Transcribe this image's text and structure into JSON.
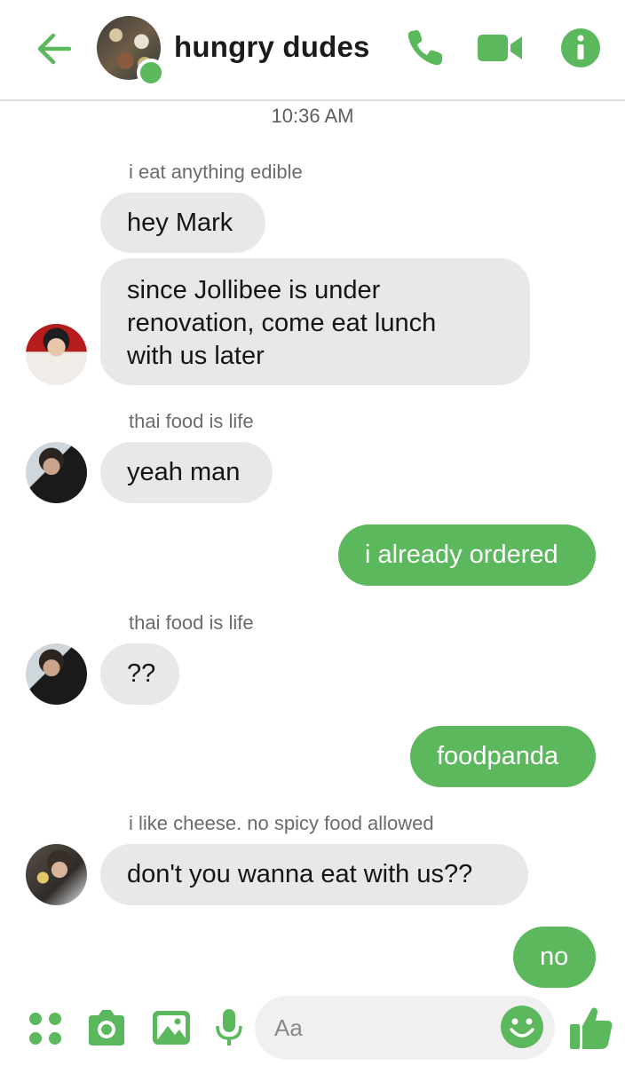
{
  "header": {
    "title": "hungry dudes",
    "back_icon": "arrow-left-icon",
    "call_icon": "phone-icon",
    "video_icon": "video-camera-icon",
    "info_icon": "info-icon",
    "accent": "#5cb85c"
  },
  "timestamp": "10:36 AM",
  "messages": [
    {
      "sender": "i eat anything edible",
      "text": "hey Mark",
      "direction": "incoming"
    },
    {
      "text": "since Jollibee is under renovation, come eat lunch with us later",
      "line1": "since Jollibee is under",
      "line2": "renovation, come eat lunch",
      "line3": "with us later",
      "direction": "incoming"
    },
    {
      "sender": "thai food is life",
      "text": "yeah man",
      "direction": "incoming"
    },
    {
      "text": "i already ordered",
      "direction": "outgoing"
    },
    {
      "sender": "thai food is life",
      "text": "??",
      "direction": "incoming"
    },
    {
      "text": "foodpanda",
      "direction": "outgoing"
    },
    {
      "sender": "i like cheese. no spicy food allowed",
      "text": "don't you wanna eat with us??",
      "direction": "incoming"
    },
    {
      "text": "no",
      "direction": "outgoing"
    }
  ],
  "composer": {
    "placeholder": "Aa",
    "icons": [
      "apps-icon",
      "camera-icon",
      "image-icon",
      "microphone-icon",
      "emoji-icon",
      "thumbs-up-icon"
    ]
  }
}
